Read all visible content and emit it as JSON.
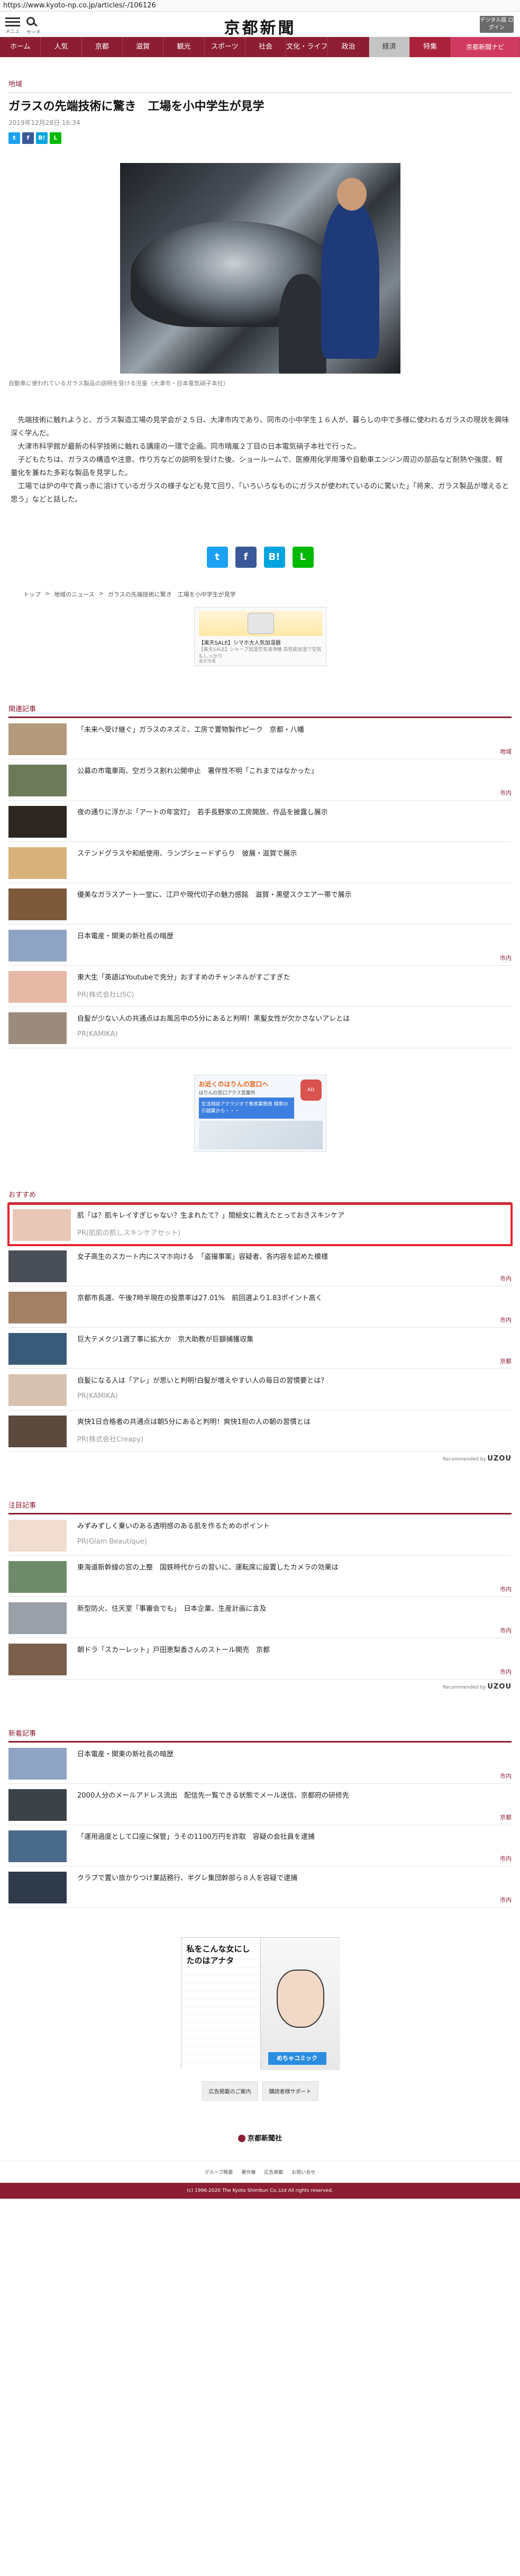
{
  "browser": {
    "url": "https://www.kyoto-np.co.jp/articles/-/106126"
  },
  "header": {
    "menu_label": "メニュー",
    "search_label": "サーチ",
    "logo": "京都新聞",
    "digital_label": "デジタル版 ログイン"
  },
  "nav": {
    "items": [
      "ホーム",
      "人気",
      "京都",
      "滋賀",
      "観光",
      "スポーツ",
      "社会",
      "文化・ライフ",
      "政治",
      "経済",
      "特集",
      "京都新聞ナビ"
    ]
  },
  "article": {
    "category": "地域",
    "title": "ガラスの先端技術に驚き　工場を小中学生が見学",
    "date": "2019年12月28日 16:34",
    "caption": "自動車に使われているガラス製品の説明を受ける児童（大津市・日本電気硝子本社）",
    "paragraphs": [
      "先端技術に触れようと、ガラス製造工場の見学会が２５日、大津市内であり、同市の小中学生１６人が、暮らしの中で多様に使われるガラスの現状を興味深く学んだ。",
      "大津市科学館が最新の科学技術に触れる講座の一環で企画。同市晴嵐２丁目の日本電気硝子本社で行った。",
      "子どもたちは、ガラスの構造や注意、作り方などの説明を受けた後、ショールームで、医療用化学用薄や自動車エンジン周辺の部品など耐熱や強度、軽量化を兼ねた多彩な製品を見学した。",
      "工場では炉の中で真っ赤に溶けているガラスの様子なども見て回り、「いろいろなものにガラスが使われているのに驚いた」「将来、ガラス製品が増えると思う」などと話した。"
    ],
    "share": {
      "twitter": "t",
      "facebook": "f",
      "hatena": "B!",
      "line": "L"
    }
  },
  "breadcrumb": [
    "トップ",
    "地域のニュース",
    "ガラスの先端技術に驚き　工場を小中学生が見学"
  ],
  "ad_top": {
    "title": "【楽天SALE】シマホ大人気加湿器",
    "text": "【楽天SALE】シャープ加湿空気清浄機 高性能加湿で空気もしっかり",
    "sponsor": "楽天市場"
  },
  "related": {
    "heading": "関連記事",
    "items": [
      {
        "title": "「未来へ受け継ぐ」ガラスのネズミ、工房で置物製作ピーク　京都・八幡",
        "tag": "地域",
        "pr": ""
      },
      {
        "title": "公募の市電車両、空ガラス割れ公開申止　署伴性不明「これまではなかった」",
        "tag": "市内",
        "pr": ""
      },
      {
        "title": "夜の通りに浮かぶ「アートの年宮灯」　若手長野家の工房開放、作品を披露し展示",
        "tag": "",
        "pr": ""
      },
      {
        "title": "ステンドグラスや和紙使用、ランプシェードずらり　彼展・滋賀で展示",
        "tag": "",
        "pr": ""
      },
      {
        "title": "優美なガラスアート一堂に、江戸や現代切子の魅力感銘　滋賀・黒壁スクエア一帯で展示",
        "tag": "",
        "pr": ""
      },
      {
        "title": "日本電産・関東の新社長の暗歴",
        "tag": "市内",
        "pr": ""
      },
      {
        "title": "東大生「英語はYoutubeで充分」おすすめのチャンネルがすごすぎた",
        "tag": "",
        "pr": "PR(株式会社LISC)"
      },
      {
        "title": "自髪が少ない人の共通点はお風呂中の5分にあると判明！黒髪女性が欠かさないアレとは",
        "tag": "",
        "pr": "PR(KAMIKA)"
      }
    ]
  },
  "ad_mid": {
    "heading": "お近くのはりんの窓口へ",
    "sub": "はりんの窓口アクス営業所",
    "blue": "生活相談アクラジオで事故業務員 検索の引越業から・・・",
    "icon": "AD"
  },
  "recommend": {
    "heading": "おすすめ",
    "items": [
      {
        "title": "肌「は？肌キレイすぎじゃない？生まれたて？」間絵女に教えたとっておきスキンケア",
        "pr": "PR(肌肌の肌しスキンケアセット)",
        "tag": ""
      },
      {
        "title": "女子高生のスカート内にスマホ向ける　「盗撮事案」容疑者、各内容を認めた模様",
        "pr": "",
        "tag": "市内"
      },
      {
        "title": "京都市長選、午後7時半現在の投票率は27.01%　前回選より1.83ポイント高く",
        "pr": "",
        "tag": "市内"
      },
      {
        "title": "巨大テメクジ1週了事に拡大か　京大助教が巨額捕獲収集",
        "pr": "",
        "tag": "京都"
      },
      {
        "title": "自髪になる人は「アレ」が思いと判明!白髪が増えやすい人の毎日の習慣要とは？",
        "pr": "PR(KAMIKA)",
        "tag": ""
      },
      {
        "title": "爽快1日合格者の共通点は朝5分にあると判明！爽快1担の人の朝の習慣とは",
        "pr": "PR(株式会社Creapy)",
        "tag": ""
      }
    ],
    "powered": "Recommended by",
    "brand": "UZOU"
  },
  "popular": {
    "heading": "注目記事",
    "items": [
      {
        "title": "みずみずしく乗いのある透明感のある肌を作るためのポイント",
        "pr": "PR(Glam Beautique)",
        "tag": ""
      },
      {
        "title": "東海道新幹線の窓の上整　国鉄時代からの習いに、運転席に設置したカメラの効果は",
        "pr": "",
        "tag": "市内"
      },
      {
        "title": "新型防火、住天室「事審会でも」　日本企業、生産計画に言及",
        "pr": "",
        "tag": "市内"
      },
      {
        "title": "朝ドラ「スカーレット」戸田恵梨香さんのストール開売　京都",
        "pr": "",
        "tag": "市内"
      }
    ],
    "powered": "Recommended by",
    "brand": "UZOU"
  },
  "latest": {
    "heading": "新着記事",
    "items": [
      {
        "title": "日本電産・関東の新社長の暗歴",
        "tag": "市内"
      },
      {
        "title": "2000人分のメールアドレス流出　配信先一覧できる状態でメール送信、京都府の研修先",
        "tag": "京都"
      },
      {
        "title": "「運用過度として口座に保管」うその1100万円を詐取　容疑の会社員を逮捕",
        "tag": "市内"
      },
      {
        "title": "クラブで置い旅かりつけ業話務行、半グレ集団幹部ら８人を容疑で逮捕",
        "tag": "市内"
      }
    ]
  },
  "ad_bottom": {
    "text": "私をこんな女にしたのはアナタ",
    "brand": "めちゃコミック"
  },
  "footer": {
    "buttons": [
      "広告掲載のご案内",
      "購読者様サポート"
    ],
    "logo": "京都新聞社",
    "links": [
      "グループ概要",
      "著作権",
      "広告掲載",
      "お問い合せ"
    ],
    "copyright": "(c) 1996-2020 The Kyoto Shimbun Co.,Ltd All rights reserved."
  }
}
